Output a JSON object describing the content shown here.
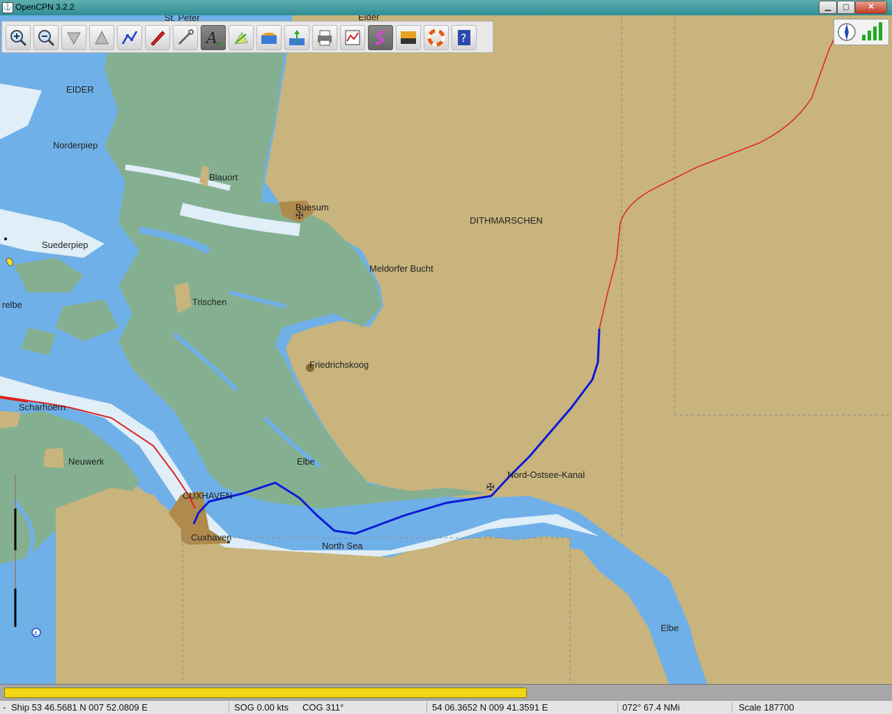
{
  "window": {
    "title": "OpenCPN 3.2.2",
    "min": "▁",
    "max": "▢",
    "close": "✕"
  },
  "toolbar": {
    "tools": [
      {
        "name": "zoom-in-icon"
      },
      {
        "name": "zoom-out-icon"
      },
      {
        "name": "chart-scale-down-icon"
      },
      {
        "name": "chart-scale-up-icon"
      },
      {
        "name": "route-icon"
      },
      {
        "name": "auto-follow-icon"
      },
      {
        "name": "settings-icon"
      },
      {
        "name": "text-icon"
      },
      {
        "name": "current-icon"
      },
      {
        "name": "tide-icon"
      },
      {
        "name": "tide-level-icon"
      },
      {
        "name": "print-icon"
      },
      {
        "name": "route-manager-icon"
      },
      {
        "name": "track-icon"
      },
      {
        "name": "color-scheme-icon"
      },
      {
        "name": "mob-icon"
      },
      {
        "name": "help-icon"
      }
    ]
  },
  "map": {
    "labels": {
      "st_peter": "St. Peter",
      "eider_top": "Eider",
      "eider": "EIDER",
      "norderpiep": "Norderpiep",
      "blauort": "Blauort",
      "buesum": "Buesum",
      "dithmarschen": "DITHMARSCHEN",
      "suederpiep": "Suederpiep",
      "meldorfer": "Meldorfer Bucht",
      "relbe": "relbe",
      "trischen": "Trischen",
      "friedrichskoog": "Friedrichskoog",
      "scharhoern": "Scharhoern",
      "neuwerk": "Neuwerk",
      "elbe_mid": "Elbe",
      "nok": "Nord-Ostsee-Kanal",
      "cuxhaven_caps": "CUXHAVEN",
      "cuxhaven": "Cuxhaven",
      "north_sea": "North Sea",
      "elbe_south": "Elbe"
    }
  },
  "status": {
    "ship": "Ship 53 46.5681 N   007 52.0809 E",
    "sog": "SOG 0.00 kts",
    "cog": "COG 311°",
    "cursor": "54 06.3652 N   009 41.3591 E",
    "bearing": "072°  67.4 NMi",
    "scale": "Scale 187700",
    "lead": "-"
  },
  "progress": {
    "value": 0.59
  }
}
